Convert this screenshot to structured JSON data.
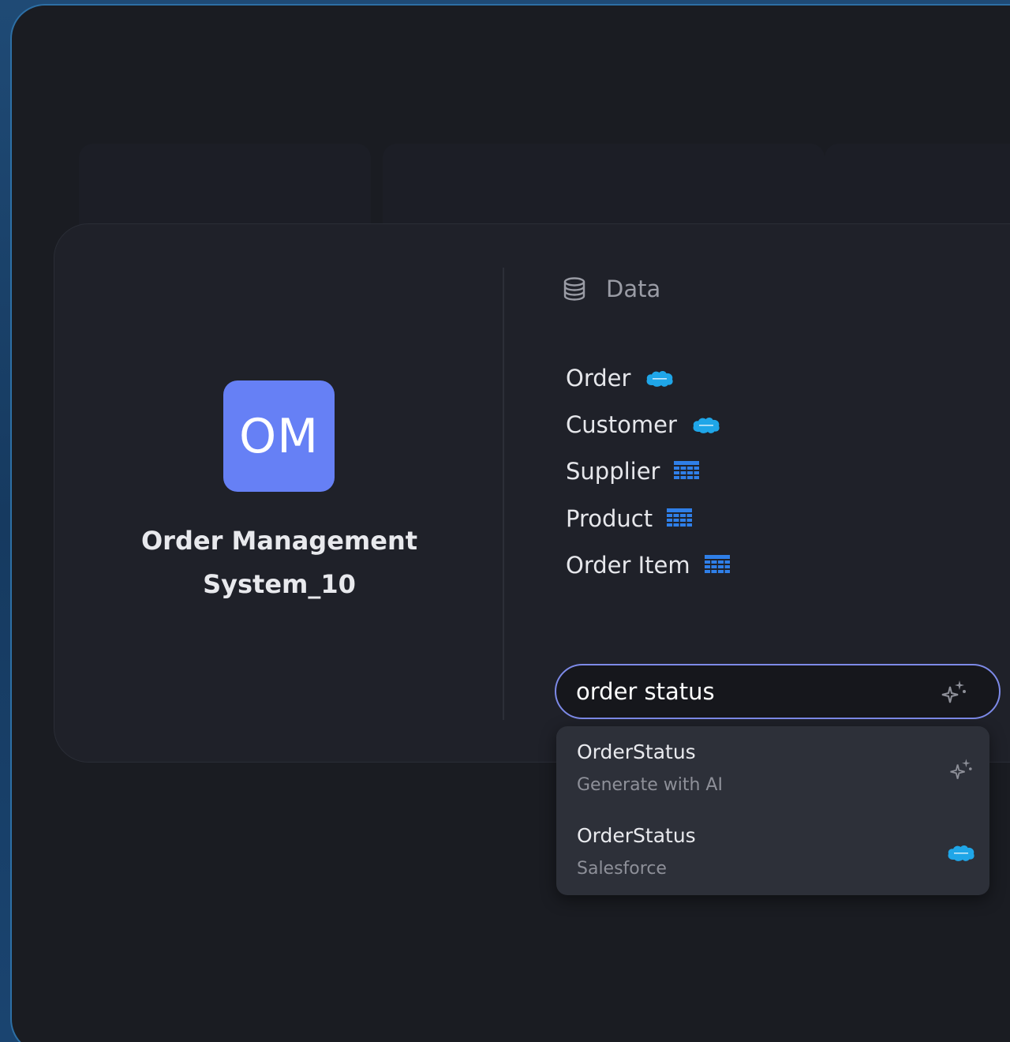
{
  "app": {
    "initials": "OM",
    "name": "Order Management System_10",
    "icon_color": "#6680f5"
  },
  "data_section": {
    "title": "Data",
    "icon": "database-icon",
    "entities": [
      {
        "label": "Order",
        "source_icon": "salesforce-cloud-icon"
      },
      {
        "label": "Customer",
        "source_icon": "salesforce-cloud-icon"
      },
      {
        "label": "Supplier",
        "source_icon": "table-grid-icon"
      },
      {
        "label": "Product",
        "source_icon": "table-grid-icon"
      },
      {
        "label": "Order Item",
        "source_icon": "table-grid-icon"
      }
    ]
  },
  "search": {
    "value": "order status",
    "icon": "ai-sparkle-icon",
    "accent": "#7d8ae8"
  },
  "suggestions": [
    {
      "title": "OrderStatus",
      "subtitle": "Generate with AI",
      "icon": "ai-sparkle-icon"
    },
    {
      "title": "OrderStatus",
      "subtitle": "Salesforce",
      "icon": "salesforce-cloud-icon"
    }
  ],
  "colors": {
    "salesforce": "#1fa6e8",
    "table_icon": "#2f7fe8"
  }
}
